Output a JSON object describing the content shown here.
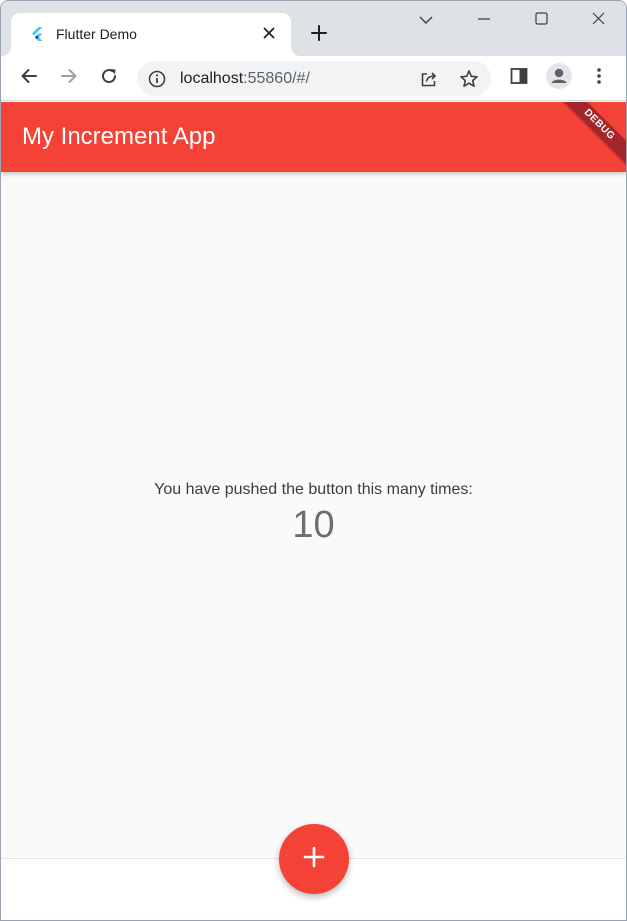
{
  "browser": {
    "tab": {
      "title": "Flutter Demo",
      "favicon": "flutter-logo-icon",
      "close_icon": "close-icon"
    },
    "new_tab_icon": "plus-icon",
    "window_controls": [
      "chevron-down-icon",
      "minimize-icon",
      "maximize-icon",
      "close-icon"
    ],
    "toolbar": {
      "back_icon": "arrow-left-icon",
      "forward_icon": "arrow-right-icon",
      "reload_icon": "reload-icon",
      "site_info_icon": "info-icon",
      "url_host": "localhost",
      "url_rest": ":55860/#/",
      "share_icon": "share-icon",
      "bookmark_icon": "star-icon",
      "side_panel_icon": "side-panel-icon",
      "profile_icon": "person-icon",
      "menu_icon": "kebab-menu-icon"
    }
  },
  "app": {
    "title": "My Increment App",
    "debug_banner": "DEBUG",
    "counter_label": "You have pushed the button this many times:",
    "counter_value": "10",
    "fab_icon": "plus-icon",
    "colors": {
      "primary": "#f44336",
      "banner": "#a2262c",
      "background": "#fafafa"
    }
  }
}
